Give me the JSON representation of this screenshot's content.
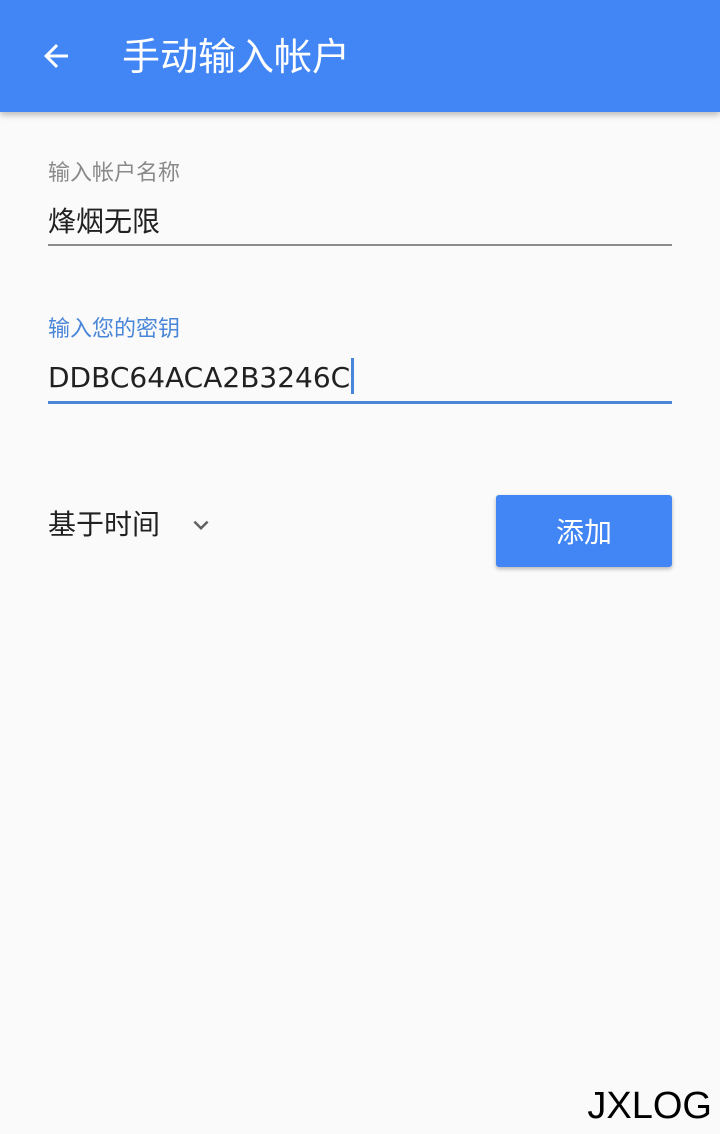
{
  "toolbar": {
    "title": "手动输入帐户",
    "back_icon": "arrow-left-icon",
    "color": "#4285f4"
  },
  "account_name": {
    "label": "输入帐户名称",
    "value": "烽烟无限"
  },
  "secret_key": {
    "label": "输入您的密钥",
    "value": "DDBC64ACA2B3246C",
    "focused": true,
    "accent_color": "#4a86d8"
  },
  "key_type": {
    "selected": "基于时间",
    "icon": "chevron-down-icon"
  },
  "add_button": {
    "label": "添加"
  },
  "watermark": {
    "text": "JXLOG"
  }
}
